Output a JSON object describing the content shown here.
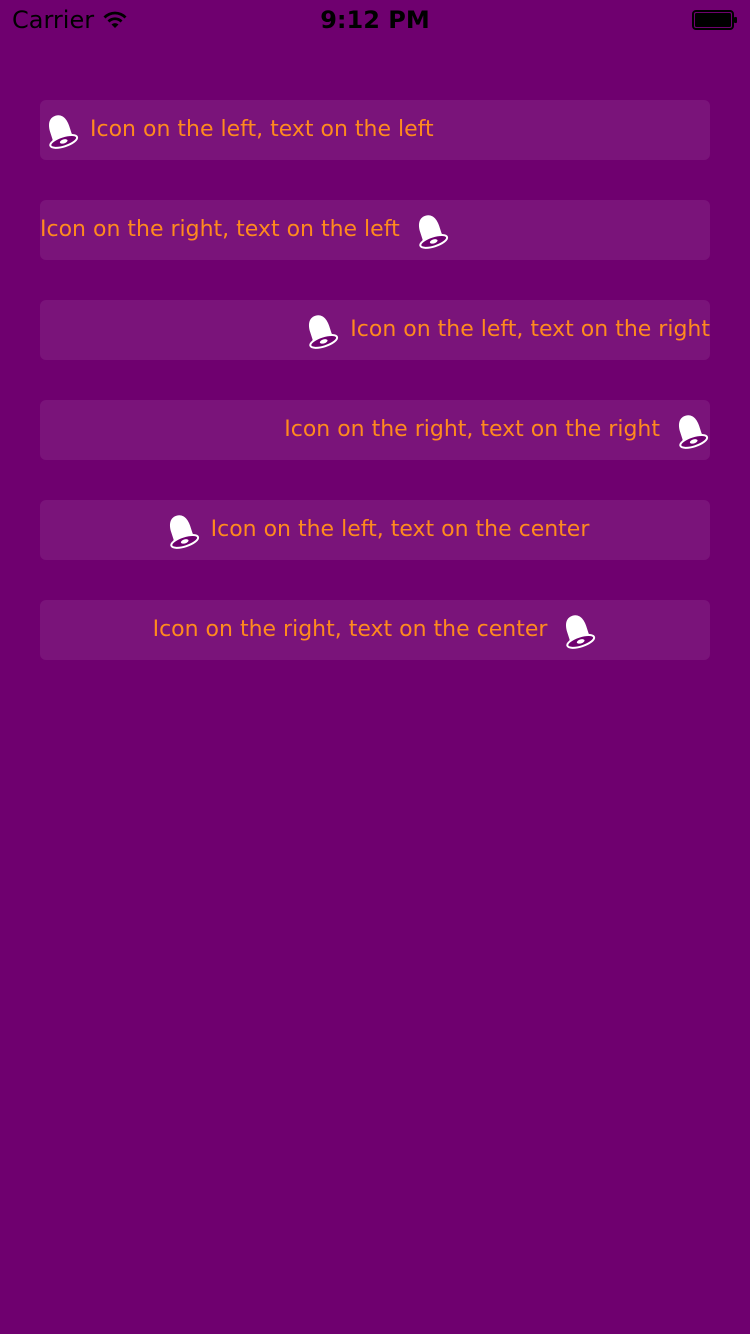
{
  "status_bar": {
    "carrier": "Carrier",
    "time": "9:12 PM",
    "icons": [
      "wifi-icon",
      "battery-icon"
    ]
  },
  "buttons": [
    {
      "label": "Icon on the left, text on the left",
      "icon": "bell-icon",
      "icon_position": "left",
      "text_alignment": "left"
    },
    {
      "label": "Icon on the right, text on the left",
      "icon": "bell-icon",
      "icon_position": "right",
      "text_alignment": "left"
    },
    {
      "label": "Icon on the left, text on the right",
      "icon": "bell-icon",
      "icon_position": "left",
      "text_alignment": "right"
    },
    {
      "label": "Icon on the right, text on the right",
      "icon": "bell-icon",
      "icon_position": "right",
      "text_alignment": "right"
    },
    {
      "label": "Icon on the left, text on the center",
      "icon": "bell-icon",
      "icon_position": "left",
      "text_alignment": "center"
    },
    {
      "label": "Icon on the right, text on the center",
      "icon": "bell-icon",
      "icon_position": "right",
      "text_alignment": "center"
    }
  ],
  "colors": {
    "background": "#6f006f",
    "button_background": "rgba(255,255,255,0.08)",
    "text": "#ff8a1e",
    "icon": "#ffffff"
  }
}
